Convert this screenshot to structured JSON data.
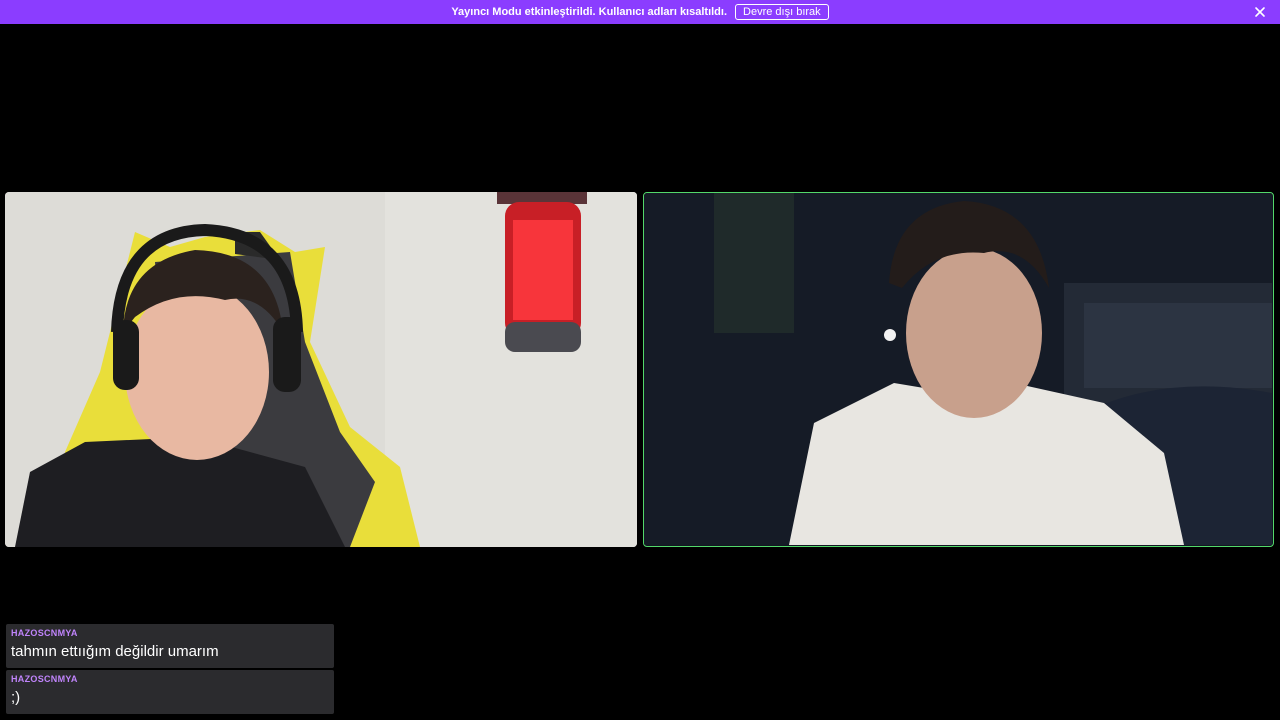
{
  "banner": {
    "message": "Yayıncı Modu etkinleştirildi. Kullanıcı adları kısaltıldı.",
    "disable_label": "Devre dışı bırak",
    "close_icon": "close-icon",
    "color": "#8b3dff"
  },
  "participants": [
    {
      "name": "participant-video-left",
      "speaking": false
    },
    {
      "name": "participant-video-right",
      "speaking": true,
      "speaking_color": "#53d86a"
    }
  ],
  "chat": {
    "username_color": "#c084fc",
    "messages": [
      {
        "user": "HAZOSCNMYA",
        "text": "tahmın ettıığım değildir umarım"
      },
      {
        "user": "HAZOSCNMYA",
        "text": ";)"
      }
    ]
  }
}
